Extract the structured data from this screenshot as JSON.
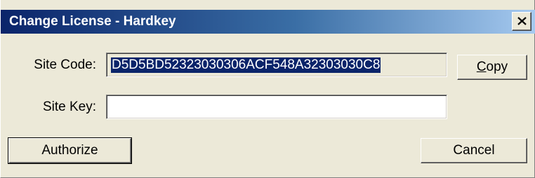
{
  "window": {
    "title": "Change License - Hardkey"
  },
  "labels": {
    "site_code": "Site Code:",
    "site_key": "Site Key:"
  },
  "fields": {
    "site_code_value": "D5D5BD52323030306ACF548A32303030C8",
    "site_key_value": ""
  },
  "buttons": {
    "copy_mnemonic": "C",
    "copy_rest": "opy",
    "authorize": "Authorize",
    "cancel": "Cancel"
  },
  "icons": {
    "close": "close-icon"
  },
  "colors": {
    "titlebar_start": "#0a246a",
    "titlebar_end": "#a6caf0",
    "selection": "#0a246a",
    "face": "#ece9d8"
  }
}
